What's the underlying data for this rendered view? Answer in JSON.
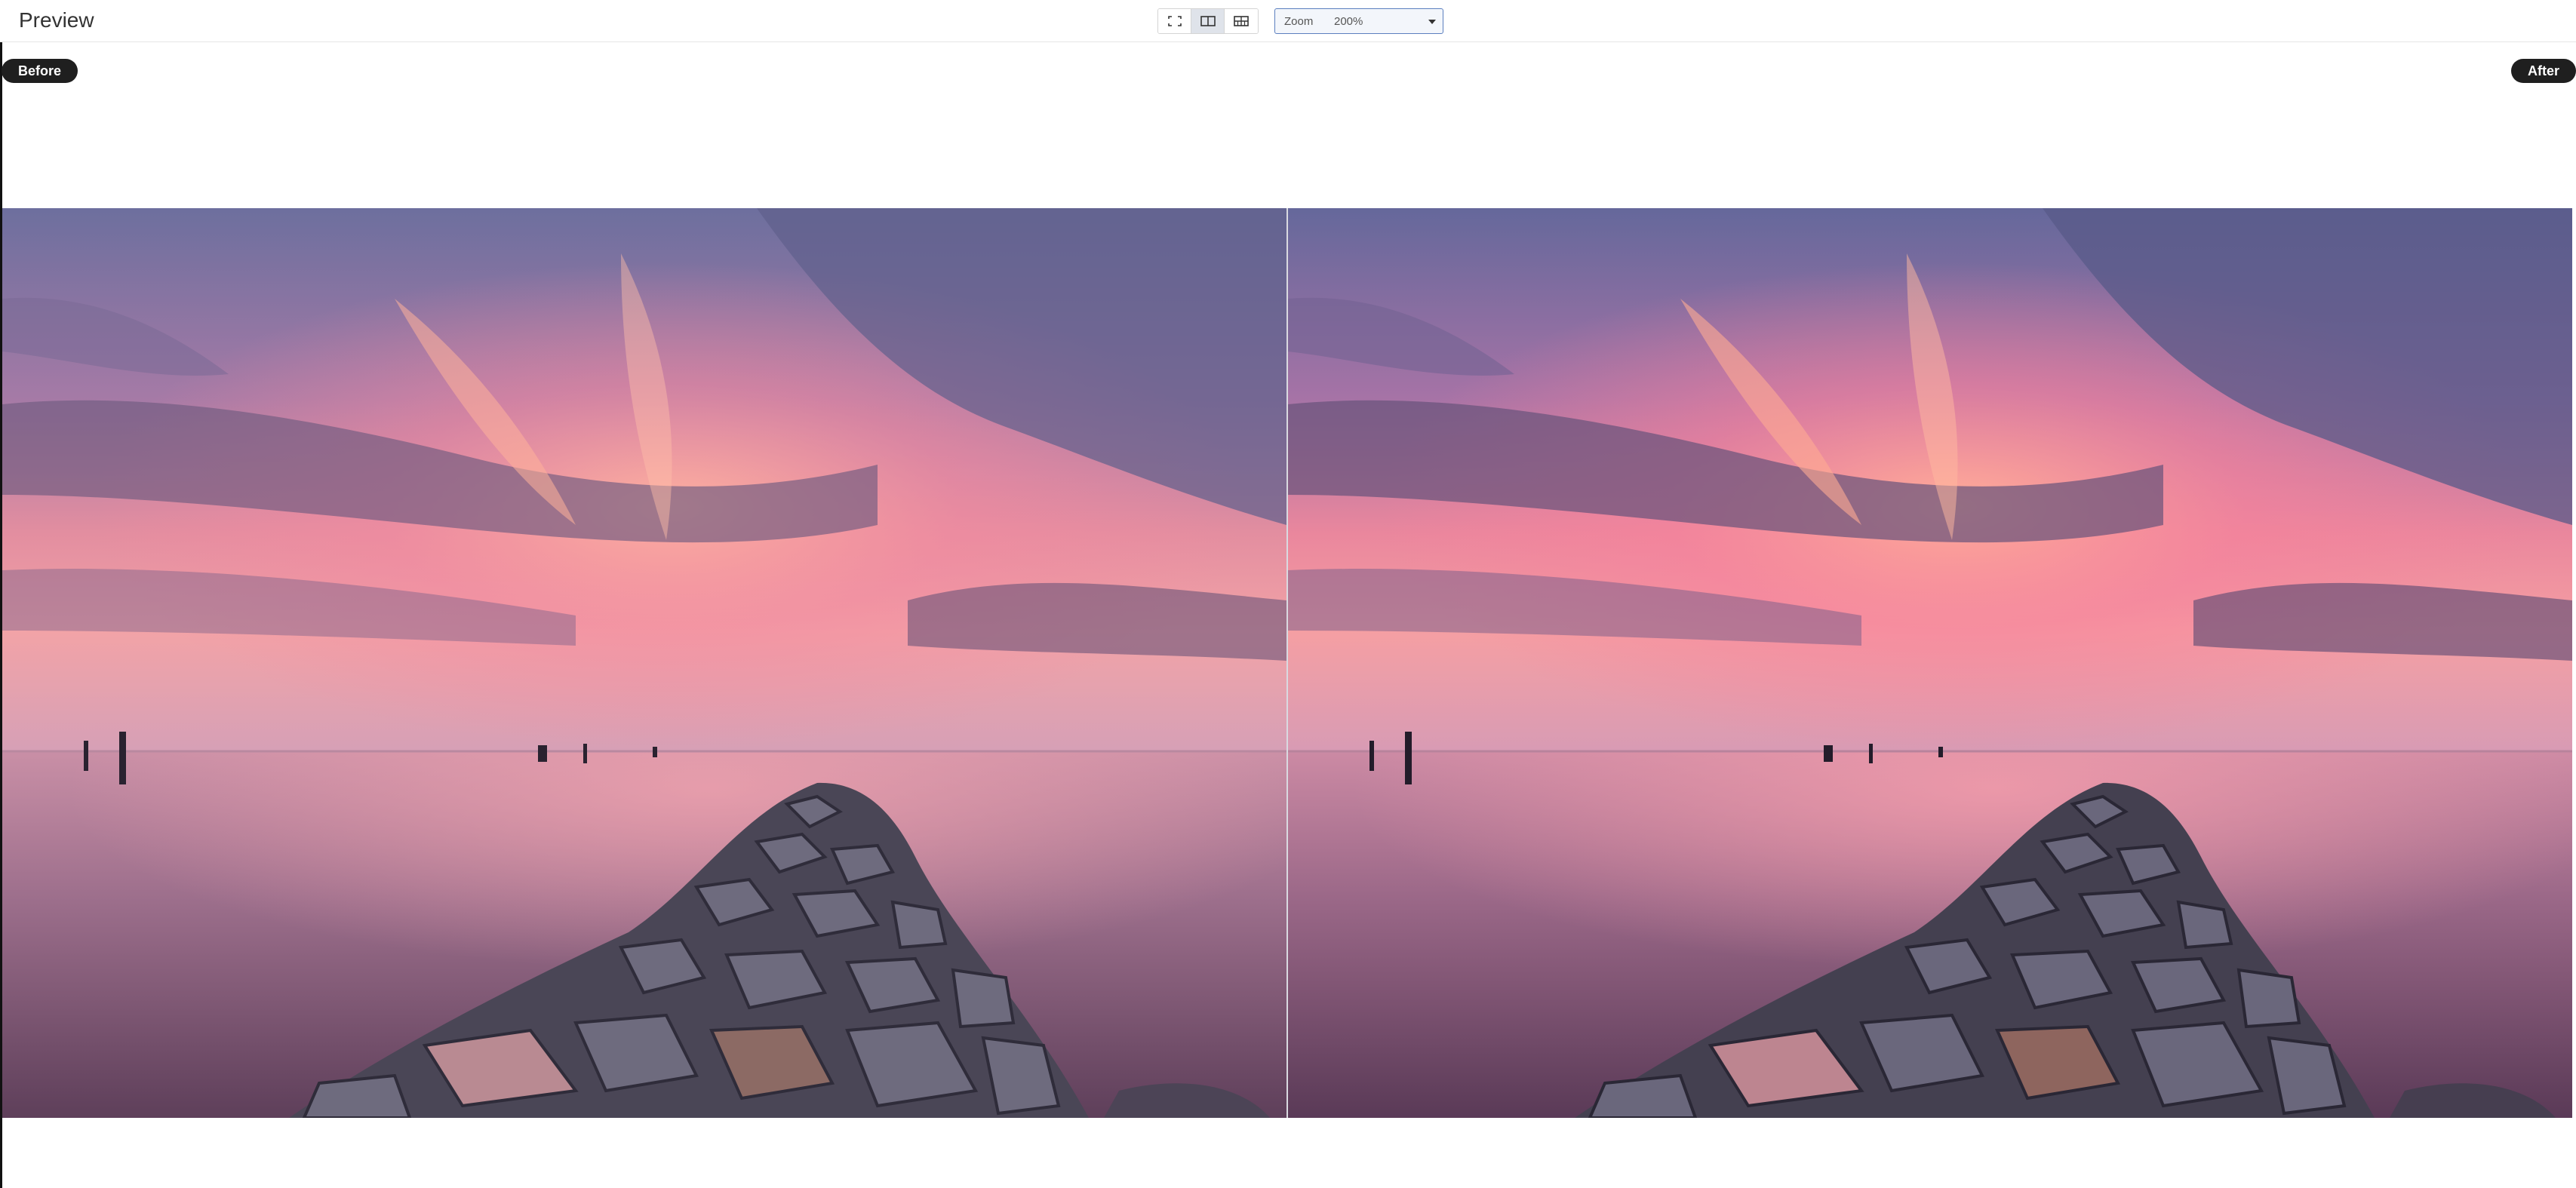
{
  "header": {
    "title": "Preview",
    "view_modes": [
      {
        "name": "fullscreen",
        "icon": "fullscreen-icon",
        "active": false
      },
      {
        "name": "side-by-side",
        "icon": "split-view-icon",
        "active": true
      },
      {
        "name": "grid",
        "icon": "grid-view-icon",
        "active": false
      }
    ],
    "zoom": {
      "label": "Zoom",
      "value": "200%"
    }
  },
  "viewer": {
    "before_label": "Before",
    "after_label": "After",
    "image_description_icon": "sunset-jetty-photo"
  },
  "colors": {
    "pill_bg": "#1f1f1f",
    "zoom_border": "#5b7fbf",
    "active_view_bg": "#dfe3ea"
  }
}
